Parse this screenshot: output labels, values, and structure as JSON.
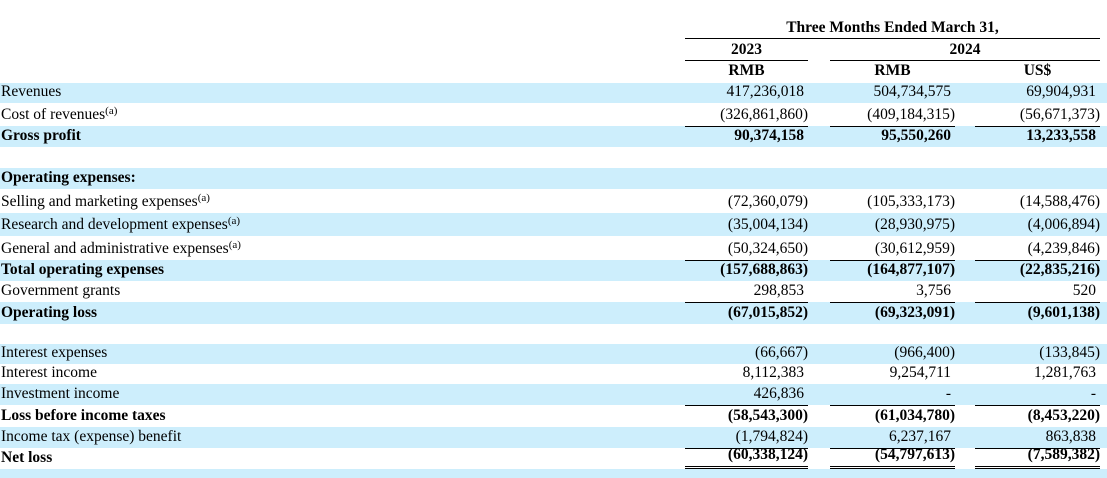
{
  "header": {
    "period": "Three Months Ended March 31,",
    "years": [
      "2023",
      "2024"
    ],
    "currencies": [
      "RMB",
      "RMB",
      "US$"
    ]
  },
  "colors": {
    "row_shade": "#cdeefc"
  },
  "rows": [
    {
      "label": "Revenues",
      "values": [
        "417,236,018",
        "504,734,575",
        "69,904,931"
      ],
      "shade": true
    },
    {
      "label": "Cost of revenues",
      "note": "(a)",
      "values": [
        "(326,861,860)",
        "(409,184,315)",
        "(56,671,373)"
      ]
    },
    {
      "label": "Gross profit",
      "values": [
        "90,374,158",
        "95,550,260",
        "13,233,558"
      ],
      "shade": true,
      "bold": true,
      "top": true
    },
    {
      "label": "",
      "values": []
    },
    {
      "label": "Operating expenses:",
      "values": [],
      "shade": true,
      "bold": true
    },
    {
      "label": "Selling and marketing expenses",
      "note": "(a)",
      "values": [
        "(72,360,079)",
        "(105,333,173)",
        "(14,588,476)"
      ]
    },
    {
      "label": "Research and development expenses",
      "note": "(a)",
      "values": [
        "(35,004,134)",
        "(28,930,975)",
        "(4,006,894)"
      ],
      "shade": true
    },
    {
      "label": "General and administrative expenses",
      "note": "(a)",
      "values": [
        "(50,324,650)",
        "(30,612,959)",
        "(4,239,846)"
      ]
    },
    {
      "label": "Total operating expenses",
      "values": [
        "(157,688,863)",
        "(164,877,107)",
        "(22,835,216)"
      ],
      "shade": true,
      "bold": true,
      "top": true
    },
    {
      "label": "Government grants",
      "values": [
        "298,853",
        "3,756",
        "520"
      ]
    },
    {
      "label": "Operating loss",
      "values": [
        "(67,015,852)",
        "(69,323,091)",
        "(9,601,138)"
      ],
      "shade": true,
      "bold": true,
      "top": true
    },
    {
      "label": "",
      "values": []
    },
    {
      "label": "Interest expenses",
      "values": [
        "(66,667)",
        "(966,400)",
        "(133,845)"
      ],
      "shade": true
    },
    {
      "label": "Interest income",
      "values": [
        "8,112,383",
        "9,254,711",
        "1,281,763"
      ]
    },
    {
      "label": "Investment income",
      "values": [
        "426,836",
        "-",
        "-"
      ],
      "shade": true
    },
    {
      "label": "Loss before income taxes",
      "values": [
        "(58,543,300)",
        "(61,034,780)",
        "(8,453,220)"
      ],
      "bold": true,
      "top": true
    },
    {
      "label": "Income tax (expense) benefit",
      "values": [
        "(1,794,824)",
        "6,237,167",
        "863,838"
      ],
      "shade": true
    },
    {
      "label": "Net loss",
      "values": [
        "(60,338,124)",
        "(54,797,613)",
        "(7,589,382)"
      ],
      "bold": true,
      "top": true,
      "double": true
    },
    {
      "label": "",
      "values": [],
      "shade": true
    }
  ]
}
